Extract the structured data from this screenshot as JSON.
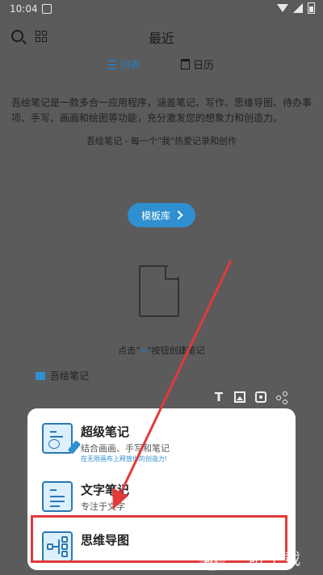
{
  "status": {
    "time": "10:04"
  },
  "header": {
    "title": "最近"
  },
  "tabs": {
    "list": "列表",
    "calendar": "日历"
  },
  "intro": {
    "text": "吾绘笔记是一款多合一应用程序，涵盖笔记、写作、思维导图、待办事项、手写、画画和绘图等功能，充分激发您的想象力和创造力。",
    "slogan": "吾绘笔记 - 每一个\"我\"热爱记录和创作"
  },
  "template_button": "模板库",
  "empty": {
    "before": "点击\"",
    "plus": "+",
    "after": "\"按钮创建笔记"
  },
  "notebook": {
    "name": "吾绘笔记",
    "color": "#2f8fd0"
  },
  "popup": {
    "options": [
      {
        "label": "超级笔记",
        "desc": "结合画画、手写和笔记",
        "sub": "在无限画布上释放你的创造力!"
      },
      {
        "label": "文字笔记",
        "desc": "专注于文字"
      },
      {
        "label": "思维导图"
      }
    ]
  },
  "watermark": {
    "logo": "听",
    "text": "一听下载"
  },
  "colors": {
    "accent": "#2f8fd0",
    "highlight": "#e23a3a"
  },
  "icons": [
    "search-icon",
    "grid-icon",
    "list-icon",
    "calendar-icon",
    "chevron-right-icon",
    "document-icon",
    "text-icon",
    "image-icon",
    "camera-icon",
    "mindmap-icon"
  ]
}
